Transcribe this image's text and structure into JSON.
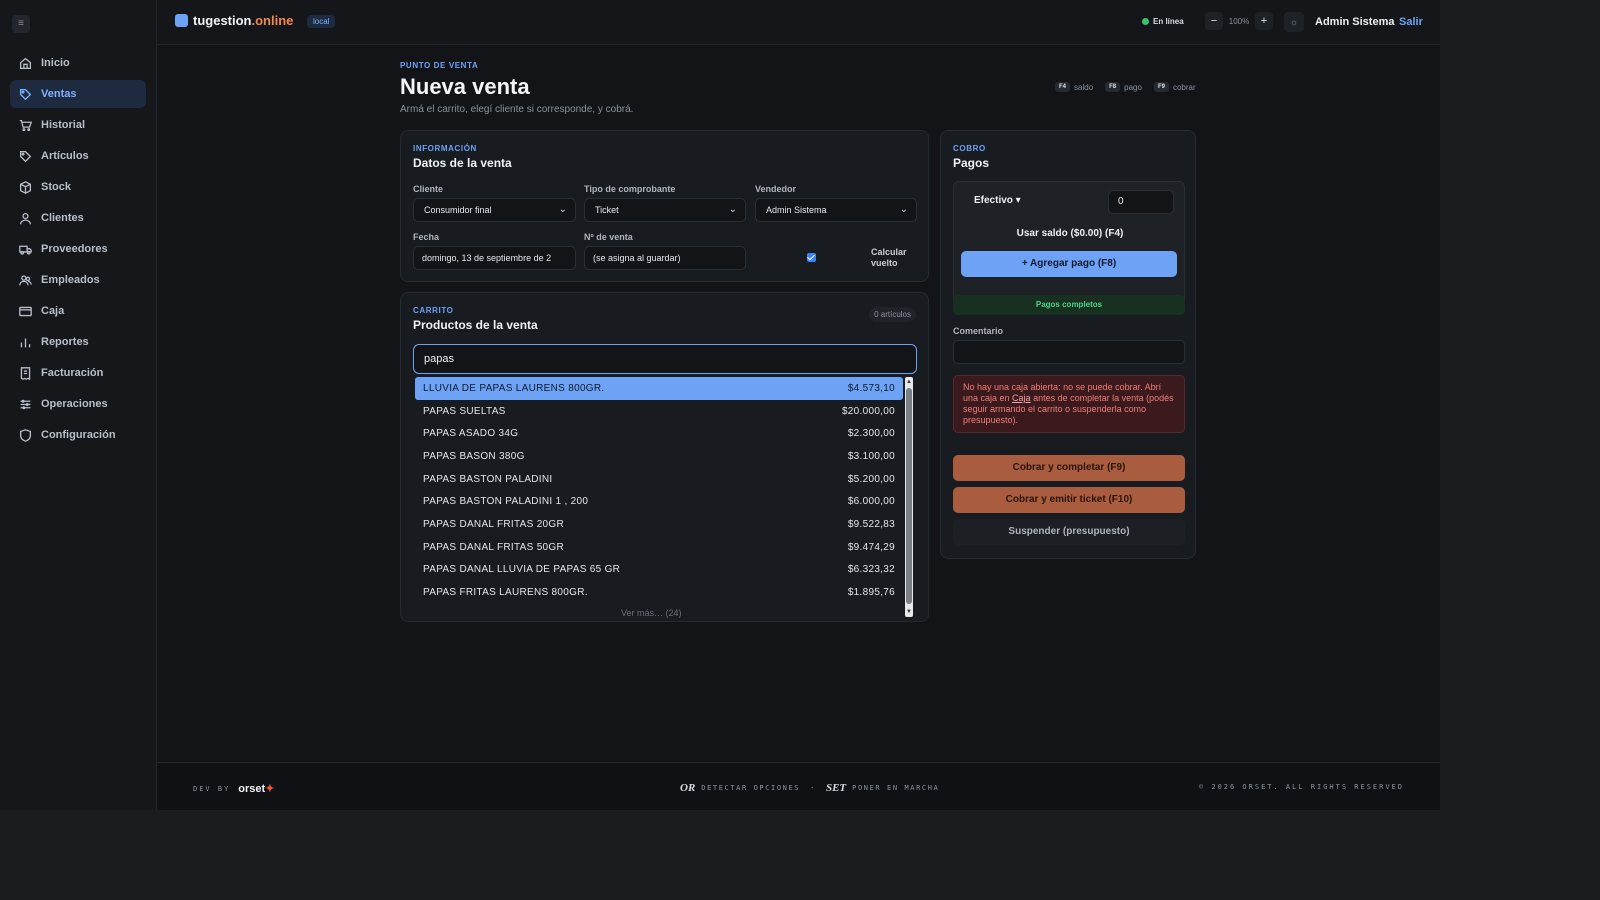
{
  "app": {
    "brand_main": "tugestion",
    "brand_suffix": ".online",
    "env_badge": "local",
    "status": "En línea",
    "zoom_level": "100%",
    "zoom_out": "−",
    "zoom_in": "+",
    "user_name": "Admin Sistema",
    "logout_label": "Salir"
  },
  "sidebar": {
    "items": [
      {
        "label": "Inicio",
        "icon": "home-icon"
      },
      {
        "label": "Ventas",
        "icon": "tag-icon",
        "active": true
      },
      {
        "label": "Historial",
        "icon": "cart-icon"
      },
      {
        "label": "Artículos",
        "icon": "tag-icon"
      },
      {
        "label": "Stock",
        "icon": "box-icon"
      },
      {
        "label": "Clientes",
        "icon": "user-icon"
      },
      {
        "label": "Proveedores",
        "icon": "truck-icon"
      },
      {
        "label": "Empleados",
        "icon": "users-icon"
      },
      {
        "label": "Caja",
        "icon": "card-icon"
      },
      {
        "label": "Reportes",
        "icon": "bar-chart-icon"
      },
      {
        "label": "Facturación",
        "icon": "receipt-icon"
      },
      {
        "label": "Operaciones",
        "icon": "sliders-icon"
      },
      {
        "label": "Configuración",
        "icon": "shield-icon"
      }
    ]
  },
  "page": {
    "eyebrow": "PUNTO DE VENTA",
    "title": "Nueva venta",
    "subtitle": "Armá el carrito, elegí cliente si corresponde, y cobrá.",
    "shortcuts": [
      {
        "key": "F4",
        "label": "saldo"
      },
      {
        "key": "F8",
        "label": "pago"
      },
      {
        "key": "F9",
        "label": "cobrar"
      }
    ]
  },
  "sale_info": {
    "eyebrow": "INFORMACIÓN",
    "title": "Datos de la venta",
    "client_label": "Cliente",
    "client_value": "Consumidor final",
    "voucher_label": "Tipo de comprobante",
    "voucher_value": "Ticket",
    "seller_label": "Vendedor",
    "seller_value": "Admin Sistema",
    "date_label": "Fecha",
    "date_value": "domingo, 13 de septiembre de 2",
    "number_label": "Nº de venta",
    "number_value": "(se asigna al guardar)",
    "change_label": "Calcular vuelto",
    "change_checked": true
  },
  "cart": {
    "eyebrow": "CARRITO",
    "title": "Productos de la venta",
    "count_badge": "0 artículos",
    "search_value": "papas",
    "results": [
      {
        "name": "LLUVIA DE PAPAS LAURENS 800GR.",
        "price": "$4.573,10"
      },
      {
        "name": "PAPAS SUELTAS",
        "price": "$20.000,00"
      },
      {
        "name": "PAPAS ASADO 34G",
        "price": "$2.300,00"
      },
      {
        "name": "PAPAS BASON 380G",
        "price": "$3.100,00"
      },
      {
        "name": "PAPAS BASTON PALADINI",
        "price": "$5.200,00"
      },
      {
        "name": "PAPAS BASTON PALADINI 1 , 200",
        "price": "$6.000,00"
      },
      {
        "name": "PAPAS DANAL FRITAS 20GR",
        "price": "$9.522,83"
      },
      {
        "name": "PAPAS DANAL FRITAS 50GR",
        "price": "$9.474,29"
      },
      {
        "name": "PAPAS DANAL LLUVIA DE PAPAS 65 GR",
        "price": "$6.323,32"
      },
      {
        "name": "PAPAS FRITAS LAURENS 800GR.",
        "price": "$1.895,76"
      }
    ],
    "more_label": "Ver más… (24)"
  },
  "payments": {
    "eyebrow": "COBRO",
    "title": "Pagos",
    "method": "Efectivo ▾",
    "amount": "0",
    "use_balance": "Usar saldo ($0.00) (F4)",
    "add_payment": "+ Agregar pago (F8)",
    "status": "Pagos completos",
    "comment_label": "Comentario",
    "alert_pre": "No hay una caja abierta: no se puede cobrar. Abrí una caja en ",
    "alert_link": "Caja",
    "alert_post": " antes de completar la venta (podés seguir armando el carrito o suspenderla como presupuesto).",
    "charge_complete": "Cobrar y completar (F9)",
    "charge_ticket": "Cobrar y emitir ticket (F10)",
    "suspend": "Suspender (presupuesto)"
  },
  "footer": {
    "dev_by": "DEV BY",
    "logo_text": "orset",
    "or_mark": "OR",
    "or_text": "DETECTAR OPCIONES",
    "dot": "·",
    "set_mark": "SET",
    "set_text": "PONER EN MARCHA",
    "copyright": "© 2026 ORSET. ALL RIGHTS RESERVED"
  },
  "colors": {
    "accent": "#6ea2f5",
    "charge": "#a95c3e",
    "success": "#4fd48a",
    "danger": "#f07c7c"
  }
}
